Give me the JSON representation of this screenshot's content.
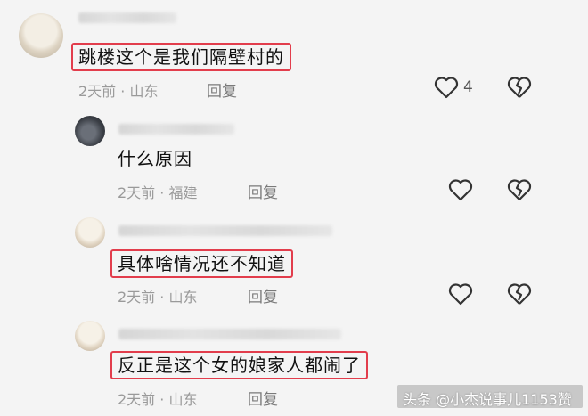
{
  "comments": [
    {
      "text": "跳楼这个是我们隔壁村的",
      "meta": "2天前 · 山东",
      "reply_label": "回复",
      "like_count": "4",
      "highlighted": true
    },
    {
      "text": "什么原因",
      "meta": "2天前 · 福建",
      "reply_label": "回复",
      "highlighted": false
    },
    {
      "text": "具体啥情况还不知道",
      "meta": "2天前 · 山东",
      "reply_label": "回复",
      "highlighted": true
    },
    {
      "text": "反正是这个女的娘家人都闹了",
      "meta": "2天前 · 山东",
      "reply_label": "回复",
      "highlighted": true
    }
  ],
  "watermark": "头条 @小杰说事儿1153赞",
  "colors": {
    "highlight_box": "#e23d4c",
    "meta": "#9a9a9a"
  },
  "icons": {
    "like": "heart-outline-icon",
    "dislike": "broken-heart-icon"
  }
}
